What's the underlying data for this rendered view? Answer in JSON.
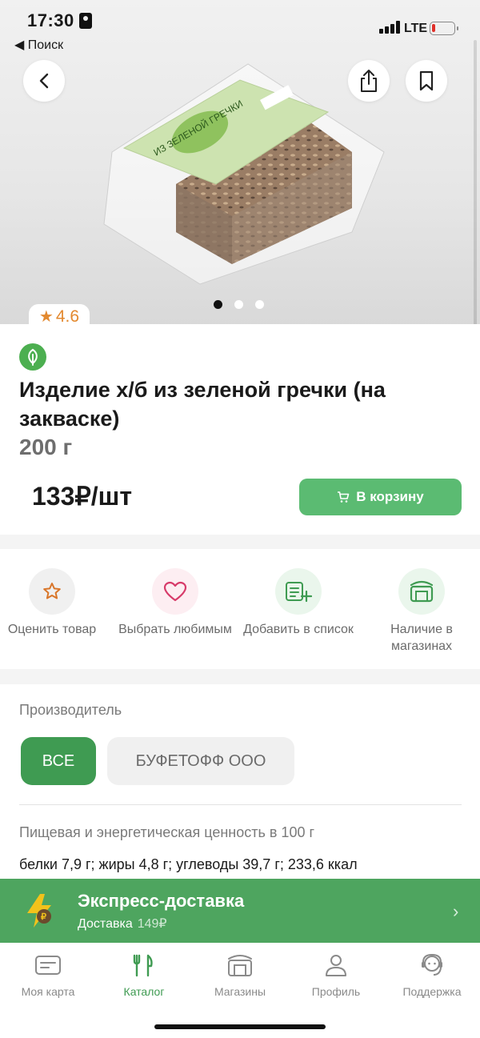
{
  "status_bar": {
    "time": "17:30",
    "back_to_app": "◀ Поиск",
    "network": "LTE"
  },
  "hero": {
    "image_alt": "Изделие х/б из зеленой гречки в упаковке",
    "package_label": "ИЗ ЗЕЛЕНОЙ ГРЕЧКИ",
    "gallery_dots": 3,
    "gallery_active_index": 0
  },
  "product": {
    "rating": "4.6",
    "title": "Изделие х/б из зеленой гречки (на закваске)",
    "weight": "200 г",
    "price": "133₽/шт",
    "add_to_cart_label": "В корзину"
  },
  "actions": [
    {
      "label": "Оценить товар",
      "icon": "star-icon"
    },
    {
      "label": "Выбрать любимым",
      "icon": "heart-icon"
    },
    {
      "label": "Добавить в список",
      "icon": "add-list-icon"
    },
    {
      "label": "Наличие в магазинах",
      "icon": "store-icon"
    }
  ],
  "producer": {
    "section_title": "Производитель",
    "chips": [
      "ВСЕ",
      "БУФЕТОФФ ООО"
    ],
    "nutrition_title": "Пищевая и энергетическая ценность в 100 г",
    "nutrition_value": "белки 7,9 г; жиры 4,8 г; углеводы 39,7 г; 233,6 ккал"
  },
  "delivery": {
    "title": "Экспресс-доставка",
    "subtitle": "Доставка",
    "price": "149₽"
  },
  "tabbar": [
    {
      "label": "Моя карта",
      "icon": "card-icon"
    },
    {
      "label": "Каталог",
      "icon": "catalog-icon"
    },
    {
      "label": "Магазины",
      "icon": "store-icon"
    },
    {
      "label": "Профиль",
      "icon": "profile-icon"
    },
    {
      "label": "Поддержка",
      "icon": "support-icon"
    }
  ],
  "colors": {
    "accent_green": "#5bbb72",
    "chip_green": "#3f9b52",
    "banner_green": "#4ea55f",
    "rating_orange": "#e3892f"
  }
}
